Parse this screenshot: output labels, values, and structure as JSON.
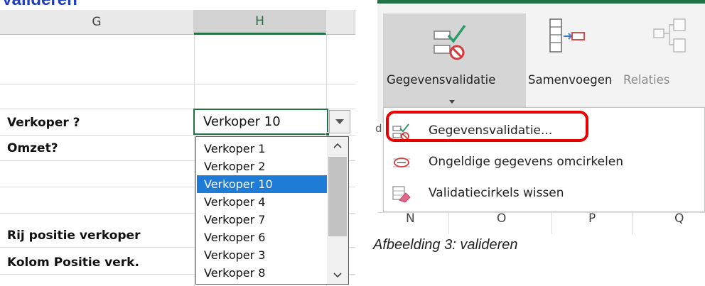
{
  "doc": {
    "heading": "Valideren",
    "caption": "Afbeelding 3: valideren"
  },
  "sheet": {
    "columns": [
      "G",
      "H"
    ],
    "labels": {
      "verkoper": "Verkoper ?",
      "omzet": "Omzet?",
      "rij": "Rij positie verkoper",
      "kolom": "Kolom Positie verk."
    },
    "active_cell_value": "Verkoper 10",
    "dropdown": {
      "items": [
        "Verkoper 1",
        "Verkoper 2",
        "Verkoper 10",
        "Verkoper 4",
        "Verkoper 7",
        "Verkoper 6",
        "Verkoper 3",
        "Verkoper 8"
      ],
      "selected": "Verkoper 10"
    }
  },
  "ribbon": {
    "buttons": {
      "validation": "Gegevensvalidatie",
      "merge": "Samenvoegen",
      "relations": "Relaties"
    },
    "menu": {
      "item1": "Gegevensvalidatie...",
      "item2": "Ongeldige gegevens omcirkelen",
      "item3": "Validatiecirkels wissen"
    },
    "under_columns": [
      "N",
      "O",
      "P",
      "Q"
    ],
    "side_letter": "d"
  },
  "colors": {
    "excel_green": "#217346",
    "selection_blue": "#1e7bd6",
    "highlight_red": "#e60000",
    "heading_blue": "#1f3fbf"
  },
  "icons": [
    "data-validation-icon",
    "merge-icon",
    "relationships-icon",
    "dropdown-arrow-icon",
    "scroll-up-icon",
    "scroll-down-icon",
    "circle-invalid-icon",
    "clear-circles-icon"
  ]
}
